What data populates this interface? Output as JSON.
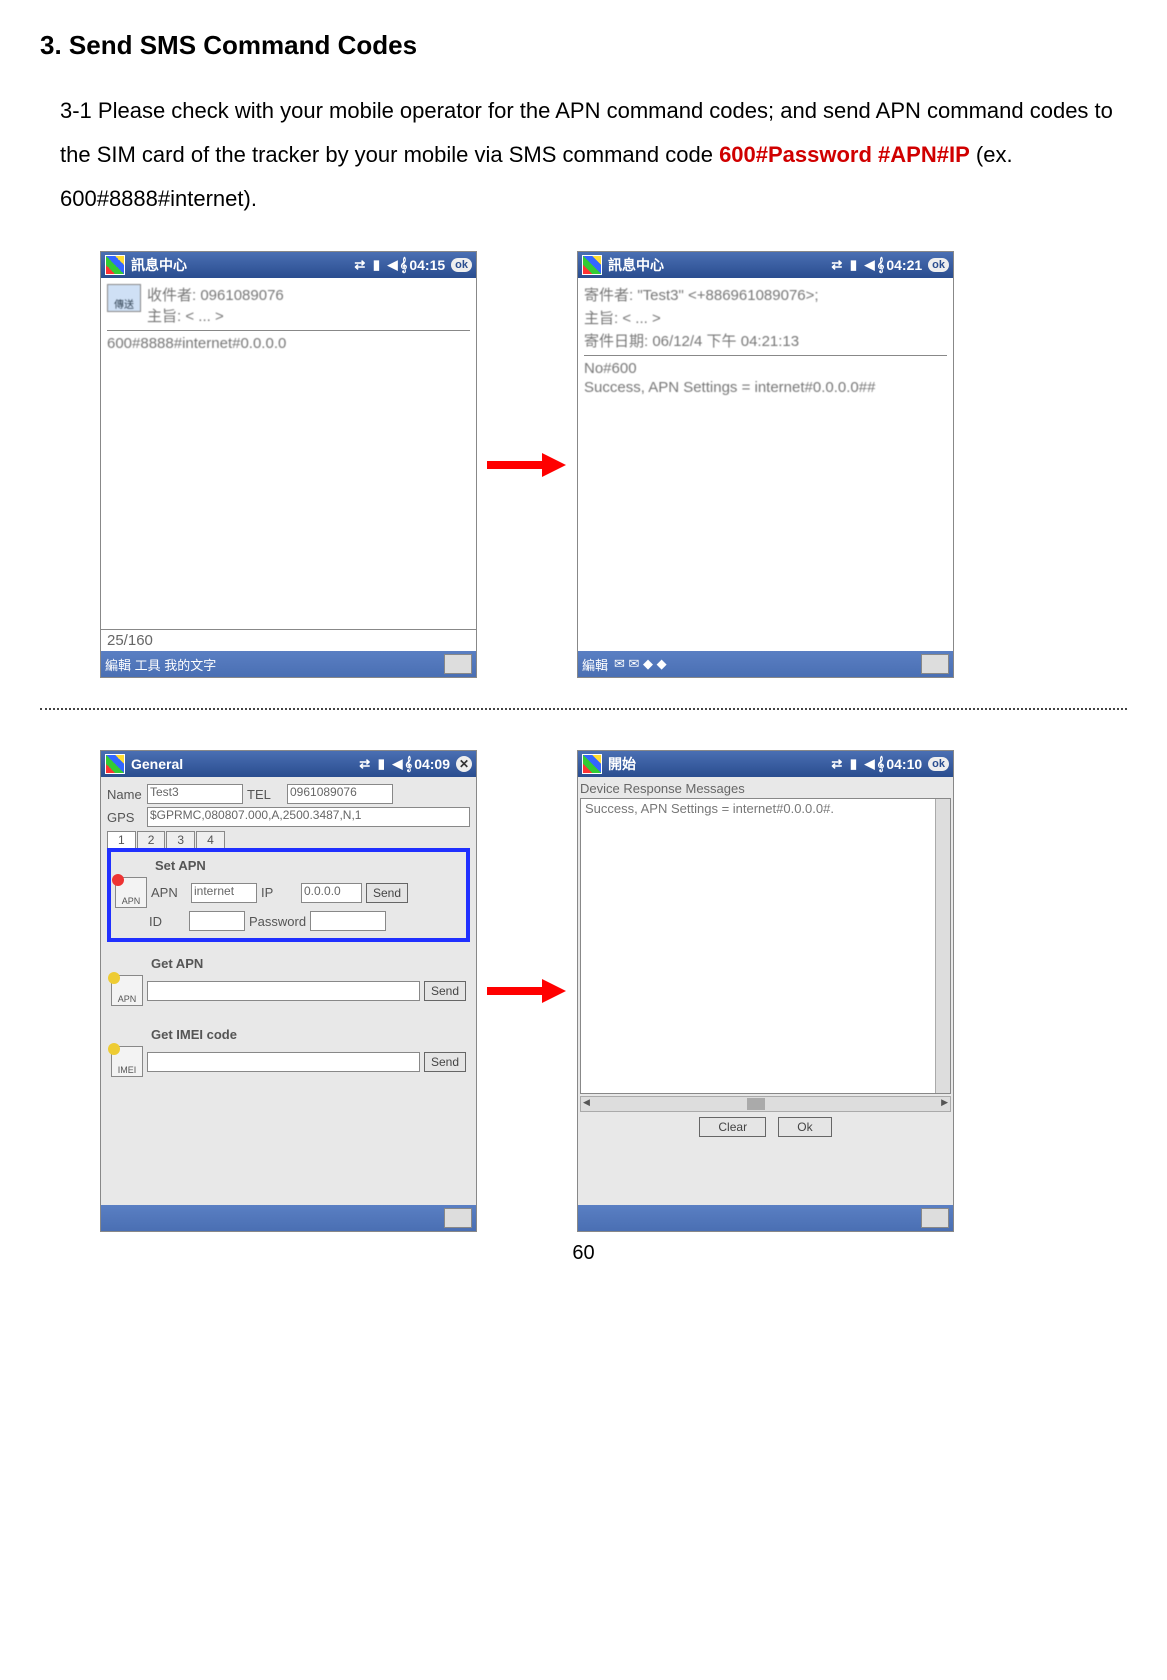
{
  "heading": "3. Send SMS Command Codes",
  "para_lead": "3-1 Please check with your mobile operator for the APN command codes; and send APN command codes to the SIM card of the tracker by your mobile via SMS command code ",
  "para_code": "600#Password #APN#IP",
  "para_tail": " (ex. 600#8888#internet).",
  "page_number": "60",
  "phone1": {
    "title": "訊息中心",
    "time": "04:15",
    "ok": "ok",
    "send_label": "傳送",
    "recipient_label": "收件者:",
    "recipient_value": "0961089076",
    "subject_label": "主旨:",
    "subject_value": "< ... >",
    "body": "600#8888#internet#0.0.0.0",
    "counter": "25/160",
    "footer": "編輯 工具 我的文字"
  },
  "phone2": {
    "title": "訊息中心",
    "time": "04:21",
    "ok": "ok",
    "from_label": "寄件者:",
    "from_value": "\"Test3\" <+886961089076>;",
    "subject_label": "主旨:",
    "subject_value": "< ... >",
    "date_label": "寄件日期:",
    "date_value": "06/12/4 下午 04:21:13",
    "body_line1": "No#600",
    "body_line2": "Success, APN Settings = internet#0.0.0.0##",
    "footer": "編輯"
  },
  "phone3": {
    "title": "General",
    "time": "04:09",
    "name_label": "Name",
    "name_value": "Test3",
    "tel_label": "TEL",
    "tel_value": "0961089076",
    "gps_label": "GPS",
    "gps_value": "$GPRMC,080807.000,A,2500.3487,N,1",
    "tabs": [
      "1",
      "2",
      "3",
      "4"
    ],
    "set_apn": {
      "title": "Set APN",
      "icon_text": "APN",
      "apn_label": "APN",
      "apn_value": "internet",
      "ip_label": "IP",
      "ip_value": "0.0.0.0",
      "id_label": "ID",
      "pw_label": "Password",
      "send": "Send"
    },
    "get_apn": {
      "title": "Get APN",
      "icon_text": "APN",
      "send": "Send"
    },
    "get_imei": {
      "title": "Get IMEI code",
      "icon_text": "IMEI",
      "send": "Send"
    }
  },
  "phone4": {
    "title": "開始",
    "time": "04:10",
    "ok": "ok",
    "header": "Device Response Messages",
    "body": "Success, APN Settings = internet#0.0.0.0#.",
    "clear": "Clear",
    "ok_btn": "Ok"
  }
}
